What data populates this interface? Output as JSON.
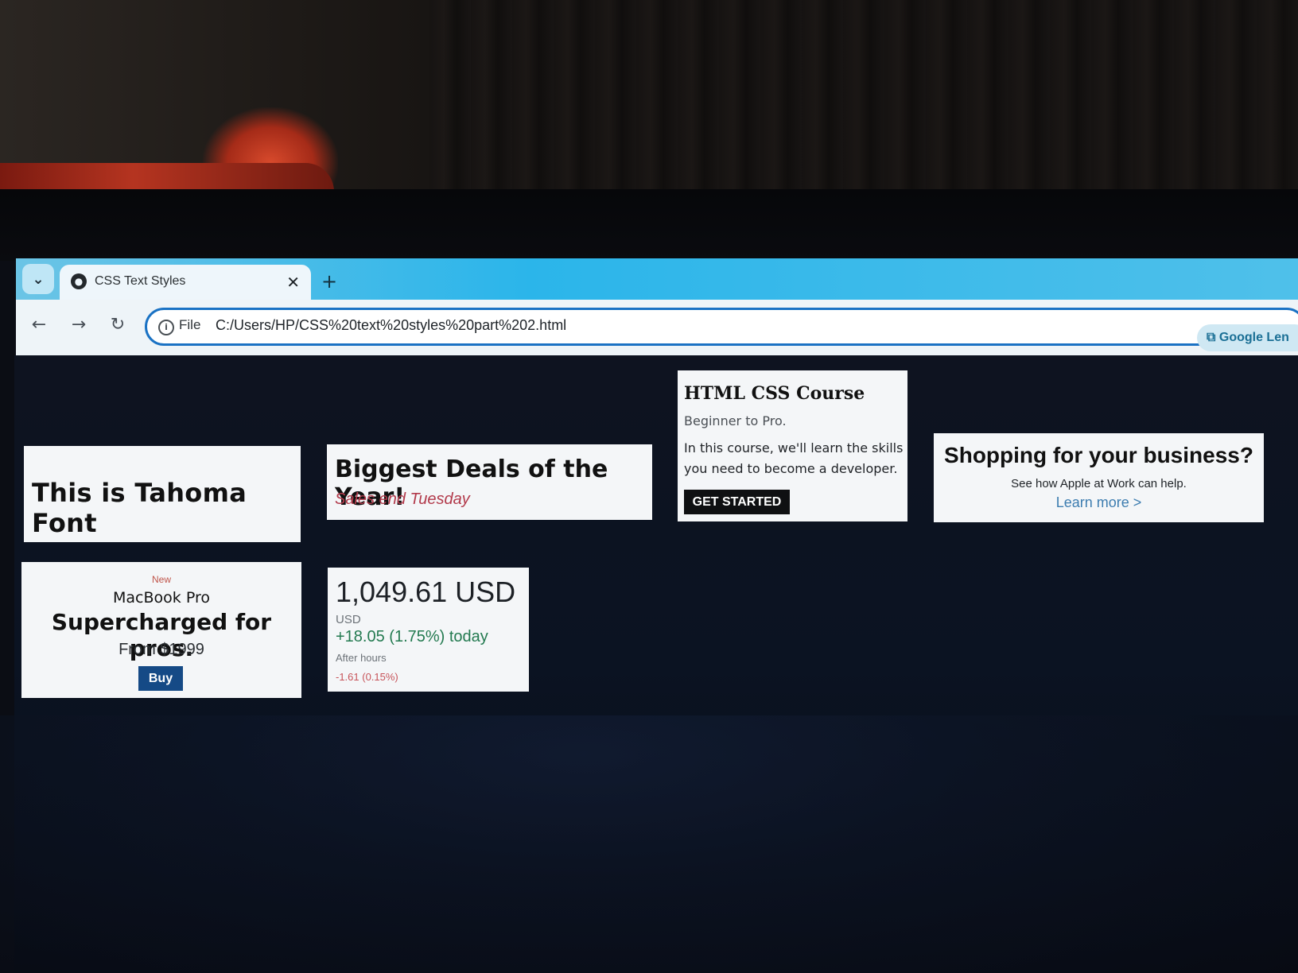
{
  "browser": {
    "tab_title": "CSS Text Styles",
    "tab_close": "✕",
    "new_tab": "+",
    "tab_list_icon": "⌄",
    "back": "←",
    "forward": "→",
    "reload": "↻",
    "site_info": "i",
    "file_chip": "File",
    "url": "C:/Users/HP/CSS%20text%20styles%20part%202.html",
    "lens_label": "Google Len"
  },
  "cards": {
    "tahoma": {
      "text": "This is Tahoma Font"
    },
    "deals": {
      "title": "Biggest Deals of the Year!",
      "subtitle": "Sales end Tuesday",
      "subtitle_color": "#b23a4b"
    },
    "course": {
      "title": "HTML CSS Course",
      "subtitle": "Beginner to Pro.",
      "description": "In this course, we'll learn the skills you need to become a developer.",
      "button": "GET STARTED"
    },
    "shopping": {
      "title": "Shopping for your business?",
      "subtitle": "See how Apple at Work can help.",
      "link": "Learn more >"
    },
    "macbook": {
      "badge": "New",
      "product": "MacBook Pro",
      "tagline": "Supercharged for pros.",
      "price": "From $1999",
      "button": "Buy",
      "button_color": "#154a86"
    },
    "stock": {
      "price": "1,049.61 USD",
      "currency": "USD",
      "change": "+18.05 (1.75%) today",
      "after_hours_label": "After hours",
      "after_hours_value": "-1.61 (0.15%)",
      "positive_color": "#237a50",
      "negative_color": "#c7545a"
    }
  },
  "colors": {
    "tab_strip": "#2bb5ea",
    "omnibox_border": "#1a72c4",
    "page_background": "#0e1320"
  }
}
